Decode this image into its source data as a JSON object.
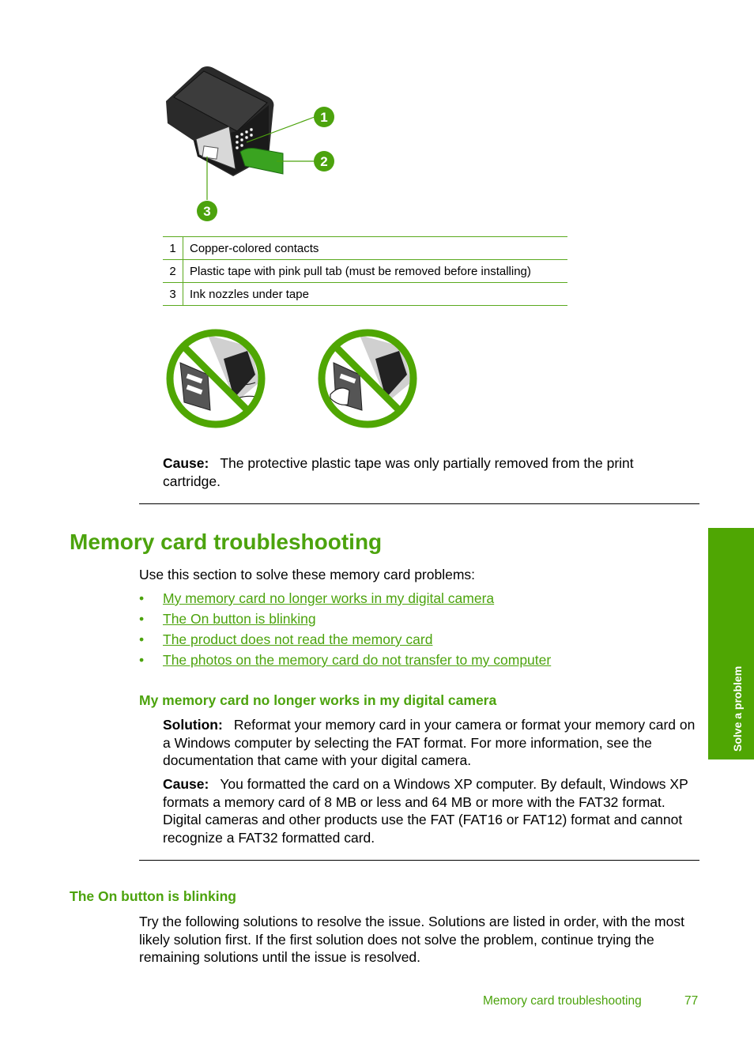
{
  "figure": {
    "callouts": [
      "1",
      "2",
      "3"
    ]
  },
  "callout_table": {
    "rows": [
      {
        "num": "1",
        "text": "Copper-colored contacts"
      },
      {
        "num": "2",
        "text": "Plastic tape with pink pull tab (must be removed before installing)"
      },
      {
        "num": "3",
        "text": "Ink nozzles under tape"
      }
    ]
  },
  "cause_tape": {
    "label": "Cause:",
    "text": "The protective plastic tape was only partially removed from the print cartridge."
  },
  "section": {
    "title": "Memory card troubleshooting",
    "intro": "Use this section to solve these memory card problems:",
    "links": [
      "My memory card no longer works in my digital camera",
      "The On button is blinking",
      "The product does not read the memory card",
      "The photos on the memory card do not transfer to my computer"
    ]
  },
  "subsection1": {
    "title": "My memory card no longer works in my digital camera",
    "solution_label": "Solution:",
    "solution_text": "Reformat your memory card in your camera or format your memory card on a Windows computer by selecting the FAT format. For more information, see the documentation that came with your digital camera.",
    "cause_label": "Cause:",
    "cause_text": "You formatted the card on a Windows XP computer. By default, Windows XP formats a memory card of 8 MB or less and 64 MB or more with the FAT32 format. Digital cameras and other products use the FAT (FAT16 or FAT12) format and cannot recognize a FAT32 formatted card."
  },
  "subsection2": {
    "title": "The On button is blinking",
    "text": "Try the following solutions to resolve the issue. Solutions are listed in order, with the most likely solution first. If the first solution does not solve the problem, continue trying the remaining solutions until the issue is resolved."
  },
  "side_tab": {
    "label": "Solve a problem"
  },
  "footer": {
    "section": "Memory card troubleshooting",
    "page": "77"
  },
  "colors": {
    "accent": "#4ca30d",
    "tab": "#4fa603"
  }
}
